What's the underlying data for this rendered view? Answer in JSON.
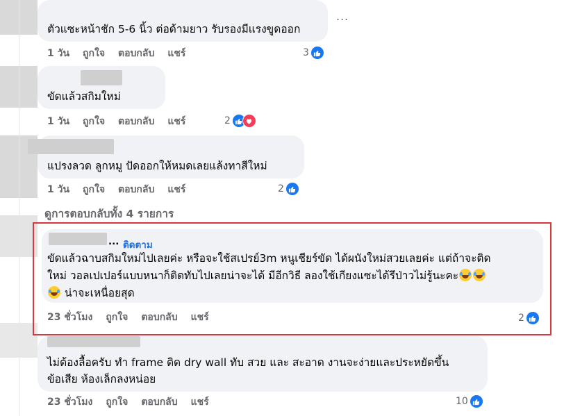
{
  "comments": [
    {
      "text": "ตัวแซะหน้าชัก 5-6 นิ้ว ต่อด้ามยาว รับรองมีแรงขูดออก",
      "time": "1 วัน",
      "like": "ถูกใจ",
      "reply": "ตอบกลับ",
      "share": "แชร์",
      "reaction_count": "3",
      "reactions": [
        "like-icon"
      ]
    },
    {
      "text": "ขัดแล้วสกิมใหม่",
      "time": "1 วัน",
      "like": "ถูกใจ",
      "reply": "ตอบกลับ",
      "share": "แชร์",
      "reaction_count": "2",
      "reactions": [
        "like-icon",
        "heart-icon"
      ]
    },
    {
      "text": "แปรงลวด ลูกหมู ปัดออกให้หมดเลยแล้งทาสีใหม่",
      "time": "1 วัน",
      "like": "ถูกใจ",
      "reply": "ตอบกลับ",
      "share": "แชร์",
      "reaction_count": "2",
      "reactions": [
        "like-icon"
      ]
    }
  ],
  "view_replies": "ดูการตอบกลับทั้ง 4 รายการ",
  "highlighted": {
    "author_suffix": "...",
    "follow": "ติดตาม",
    "line1": "ขัดแล้วฉาบสกิมใหม่ไปเลยค่ะ หรือจะใช้สเปรย์3m หนูเชียร์ขัด ได้ผนังใหม่สวยเลยค่ะ แต่ถ้าจะติด",
    "line2": "ใหม่ วอลเปเปอร์แบบหนาก็ติดทับไปเลยน่าจะได้ มีอีกวิธี ลองใช้เกียงแซะได้รึป่าวไม่รู้นะคะ",
    "line3": "น่าจะเหนื่อยสุด",
    "time": "23 ชั่วโมง",
    "like": "ถูกใจ",
    "reply": "ตอบกลับ",
    "share": "แชร์",
    "reaction_count": "2",
    "emoji": "grinning-sweat-emoji",
    "highlight_color": "#d9363e"
  },
  "last": {
    "line1": "ไม่ต้องลื้อครับ ทำ frame ติด dry wall ทับ สวย และ สะอาด งานจะง่ายและประหยัดขึ้น",
    "line2": "ข้อเสีย ห้องเล็กลงหน่อย",
    "time": "23 ชั่วโมง",
    "like": "ถูกใจ",
    "reply": "ตอบกลับ",
    "share": "แชร์",
    "reaction_count": "10"
  },
  "more_options": "...",
  "colors": {
    "bubble": "#f0f2f5",
    "secondary_text": "#65676b",
    "like_blue": "#1877f2",
    "heart_red": "#f33e58",
    "link_blue": "#216fdb"
  }
}
